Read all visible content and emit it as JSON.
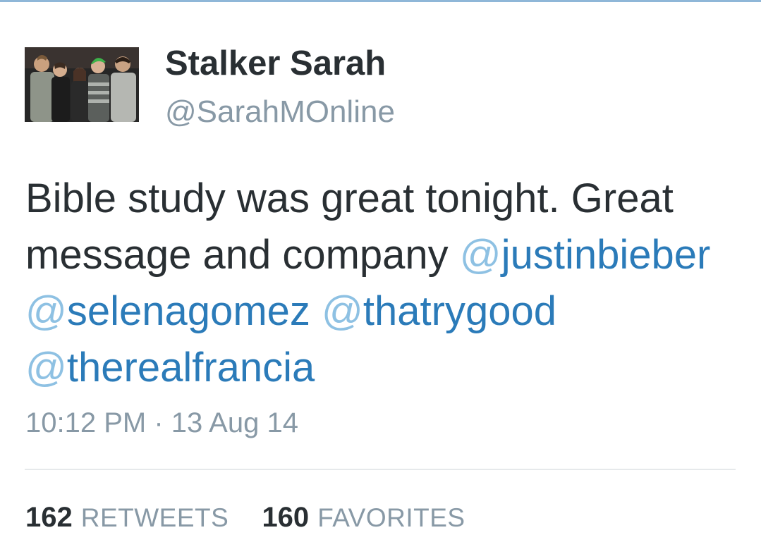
{
  "user": {
    "display_name": "Stalker Sarah",
    "handle": "@SarahMOnline"
  },
  "tweet": {
    "line1": "Bible study was great tonight. Great",
    "line2_text": "message and company ",
    "mentions": [
      {
        "at": "@",
        "name": "justinbieber"
      },
      {
        "at": "@",
        "name": "selenagomez"
      },
      {
        "at": "@",
        "name": "thatrygood"
      },
      {
        "at": "@",
        "name": "therealfrancia"
      }
    ],
    "timestamp": "10:12 PM · 13 Aug 14"
  },
  "stats": {
    "retweets_count": "162",
    "retweets_label": "RETWEETS",
    "favorites_count": "160",
    "favorites_label": "FAVORITES"
  },
  "colors": {
    "accent_rule": "#8fb7d8",
    "mention": "#2b7bb9",
    "mention_at": "#8ec1e3",
    "muted": "#8899a6",
    "text": "#292f33"
  }
}
